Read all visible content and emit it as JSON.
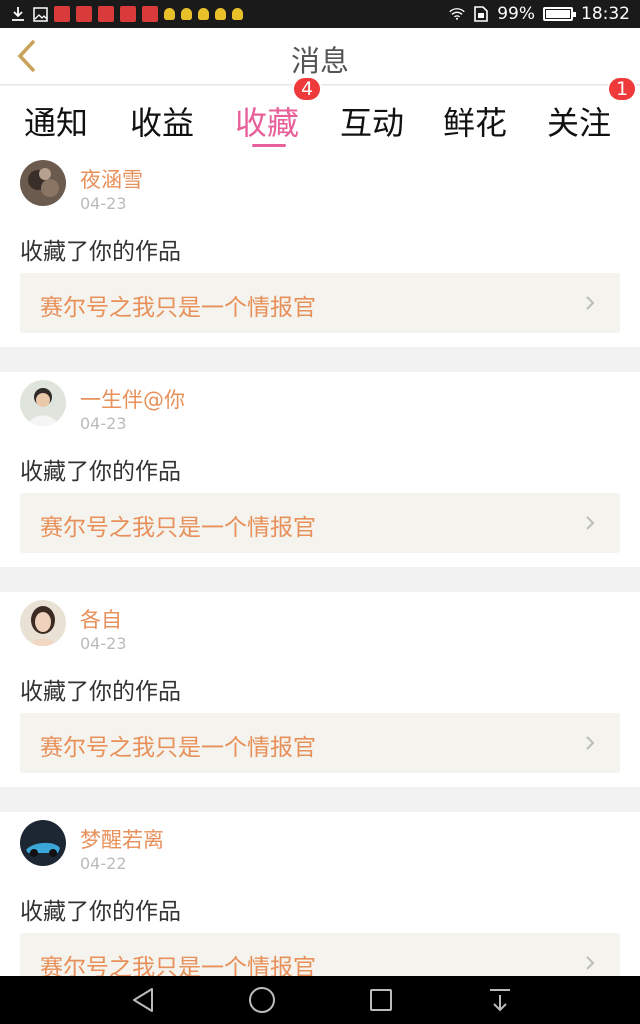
{
  "status_bar": {
    "battery": "99%",
    "time": "18:32",
    "battery_level": 0.99,
    "icons": [
      "download-icon",
      "image-icon",
      "red-envelope-icon",
      "red-envelope-icon",
      "red-envelope-icon",
      "red-envelope-icon",
      "red-envelope-icon",
      "bulb-icon",
      "bulb-icon",
      "bulb-icon",
      "bulb-icon",
      "bulb-icon",
      "wifi-icon",
      "sim-icon",
      "battery-icon"
    ]
  },
  "header": {
    "title": "消息"
  },
  "tabs": [
    {
      "label": "通知",
      "active": false
    },
    {
      "label": "收益",
      "active": false
    },
    {
      "label": "收藏",
      "active": true,
      "badge": "4"
    },
    {
      "label": "互动",
      "active": false
    },
    {
      "label": "鲜花",
      "active": false
    },
    {
      "label": "关注",
      "active": false,
      "badge": "1"
    }
  ],
  "messages": [
    {
      "user": "夜涵雪",
      "date": "04-23",
      "action": "收藏了你的作品",
      "work": "赛尔号之我只是一个情报官",
      "avatar_color": "#6b5a4e"
    },
    {
      "user": "一生伴@你",
      "date": "04-23",
      "action": "收藏了你的作品",
      "work": "赛尔号之我只是一个情报官",
      "avatar_color": "#3d4a3a"
    },
    {
      "user": "各自",
      "date": "04-23",
      "action": "收藏了你的作品",
      "work": "赛尔号之我只是一个情报官",
      "avatar_color": "#c9a98a"
    },
    {
      "user": "梦醒若离",
      "date": "04-22",
      "action": "收藏了你的作品",
      "work": "赛尔号之我只是一个情报官",
      "avatar_color": "#2b4e6e"
    }
  ],
  "colors": {
    "accent": "#e8609a",
    "username": "#e8905a",
    "badge": "#ee3a3a"
  }
}
